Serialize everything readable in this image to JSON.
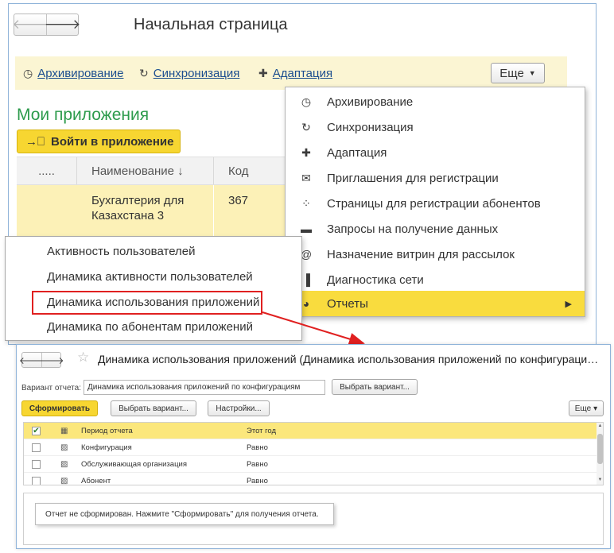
{
  "main": {
    "nav": {
      "back": "🡐",
      "forward": "🡒"
    },
    "title": "Начальная страница",
    "toolbar": {
      "links": [
        {
          "icon": "clock-icon",
          "glyph": "◷",
          "label": "Архивирование"
        },
        {
          "icon": "refresh-icon",
          "glyph": "↻",
          "label": "Синхронизация"
        },
        {
          "icon": "puzzle-icon",
          "glyph": "✚",
          "label": "Адаптация"
        }
      ],
      "more_label": "Еще",
      "more_arrow": "▼"
    },
    "section_title": "Мои приложения",
    "enter_button": {
      "icon": "→⎕",
      "label": "Войти в приложение"
    },
    "table": {
      "headers": [
        ".....",
        "Наименование  ↓",
        "Код"
      ],
      "rows": [
        {
          "name": "Бухгалтерия для Казахстана 3",
          "code": "367"
        }
      ]
    }
  },
  "dropdown": {
    "items": [
      {
        "icon": "clock-icon",
        "glyph": "◷",
        "label": "Архивирование"
      },
      {
        "icon": "refresh-icon",
        "glyph": "↻",
        "label": "Синхронизация"
      },
      {
        "icon": "puzzle-icon",
        "glyph": "✚",
        "label": "Адаптация"
      },
      {
        "icon": "envelope-icon",
        "glyph": "✉",
        "label": "Приглашения для регистрации"
      },
      {
        "icon": "nodes-icon",
        "glyph": "⁘",
        "label": "Страницы для регистрации абонентов"
      },
      {
        "icon": "chat-icon",
        "glyph": "▬",
        "label": "Запросы на получение данных"
      },
      {
        "icon": "at-icon",
        "glyph": "@",
        "label": "Назначение витрин для рассылок"
      },
      {
        "icon": "bar-chart-icon",
        "glyph": "▐",
        "label": "Диагностика сети"
      },
      {
        "icon": "pie-chart-icon",
        "glyph": "◕",
        "label": "Отчеты",
        "submenu_arrow": "▶"
      }
    ]
  },
  "submenu": {
    "items": [
      "Активность пользователей",
      "Динамика активности пользователей",
      "Динамика использования приложений",
      "Динамика по абонентам приложений"
    ]
  },
  "report": {
    "nav": {
      "back": "🡐",
      "forward": "🡒"
    },
    "star": "☆",
    "title": "Динамика использования приложений (Динамика использования приложений по конфигурации…",
    "variant_label": "Вариант отчета:",
    "variant_value": "Динамика использования приложений по конфигурациям",
    "choose_variant_top": "Выбрать вариант...",
    "generate": "Сформировать",
    "choose_variant": "Выбрать вариант...",
    "settings": "Настройки...",
    "more": "Еще",
    "more_arrow": "▾",
    "table": [
      {
        "checked": "✔",
        "name": "Период отчета",
        "value": "Этот год"
      },
      {
        "checked": "",
        "name": "Конфигурация",
        "value": "Равно"
      },
      {
        "checked": "",
        "name": "Обслуживающая организация",
        "value": "Равно"
      },
      {
        "checked": "",
        "name": "Абонент",
        "value": "Равно"
      }
    ],
    "notice": "Отчет не сформирован. Нажмите \"Сформировать\" для получения отчета."
  },
  "colors": {
    "accent_yellow": "#f7d631",
    "link_blue": "#1c4e8f",
    "title_green": "#2d9b4c",
    "highlight_red": "#e02020"
  }
}
